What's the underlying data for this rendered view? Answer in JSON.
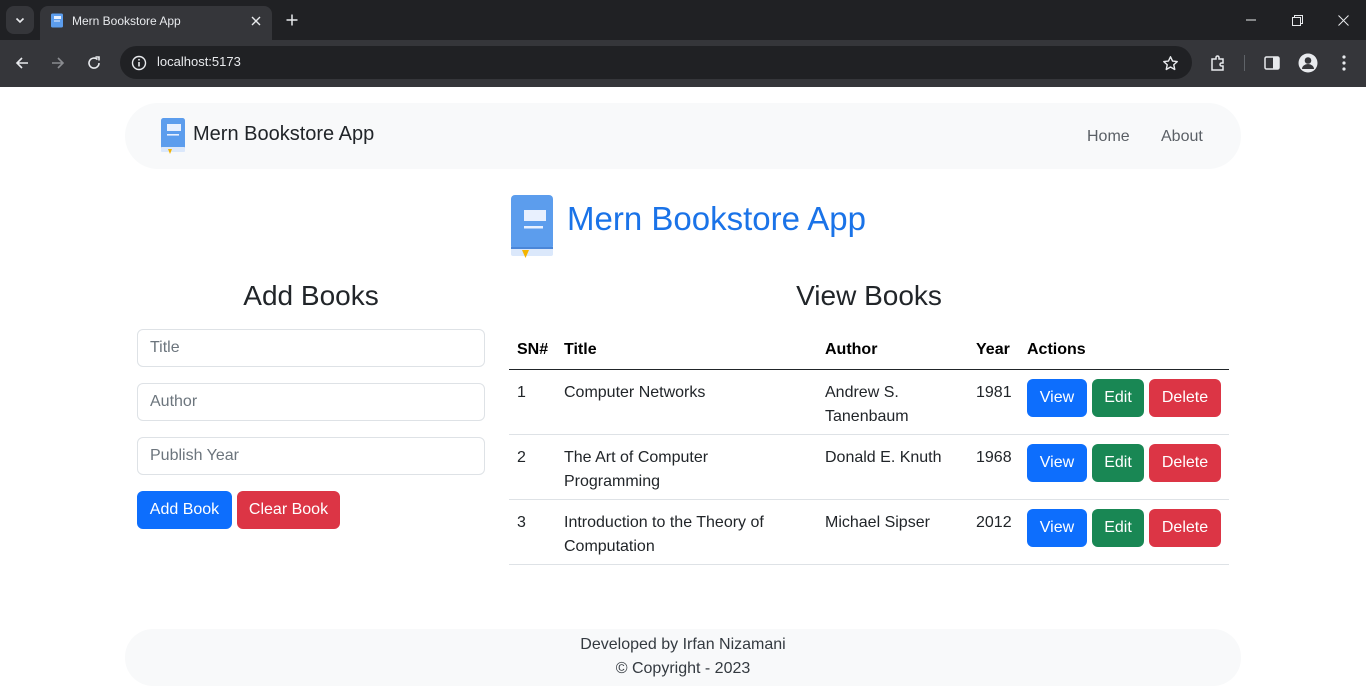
{
  "browser": {
    "tab_title": "Mern Bookstore App",
    "url": "localhost:5173"
  },
  "navbar": {
    "brand": "Mern Bookstore App",
    "links": [
      "Home",
      "About"
    ]
  },
  "hero": {
    "title": "Mern Bookstore App"
  },
  "add_books": {
    "heading": "Add Books",
    "title_placeholder": "Title",
    "author_placeholder": "Author",
    "year_placeholder": "Publish Year",
    "add_label": "Add Book",
    "clear_label": "Clear Book"
  },
  "view_books": {
    "heading": "View Books",
    "columns": [
      "SN#",
      "Title",
      "Author",
      "Year",
      "Actions"
    ],
    "rows": [
      {
        "sn": "1",
        "title": "Computer Networks",
        "author": "Andrew S. Tanenbaum",
        "year": "1981"
      },
      {
        "sn": "2",
        "title": "The Art of Computer Programming",
        "author": "Donald E. Knuth",
        "year": "1968"
      },
      {
        "sn": "3",
        "title": "Introduction to the Theory of Computation",
        "author": "Michael Sipser",
        "year": "2012"
      }
    ],
    "actions": {
      "view": "View",
      "edit": "Edit",
      "delete": "Delete"
    }
  },
  "footer": {
    "line1": "Developed by Irfan Nizamani",
    "line2": "© Copyright - 2023"
  },
  "colors": {
    "primary": "#0d6efd",
    "success": "#198754",
    "danger": "#dc3545",
    "hero_title": "#1a73e8",
    "navbar_bg": "#f8f9fa"
  },
  "icons": {
    "book": "book-icon",
    "star": "bookmark-star-icon",
    "extensions": "puzzle-icon",
    "profile": "profile-icon"
  }
}
